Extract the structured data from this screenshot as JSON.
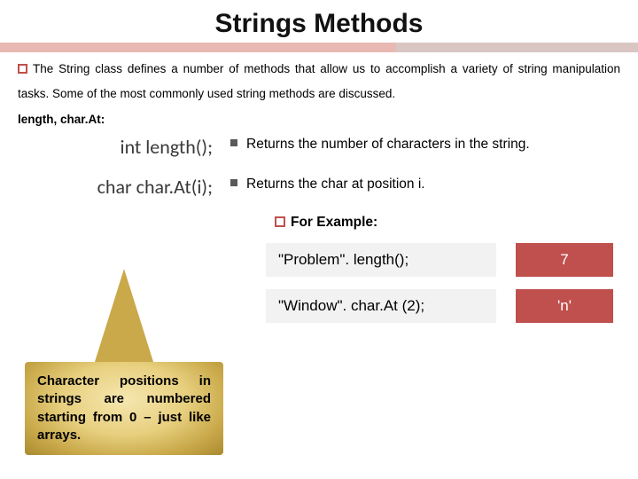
{
  "title": "Strings Methods",
  "intro": "The String class defines a number of methods that allow us to accomplish a variety of string manipulation tasks. Some of the most commonly used string methods are discussed.",
  "subhead": "length, char.At:",
  "methods": [
    {
      "sig": "int length();",
      "desc": "Returns the number of characters in the string."
    },
    {
      "sig": "char char.At(i);",
      "desc": "Returns the char at position i."
    }
  ],
  "example_label": "For Example:",
  "examples": [
    {
      "call": "\"Problem\". length();",
      "result": "7"
    },
    {
      "call": "\"Window\". char.At (2);",
      "result": "'n'"
    }
  ],
  "callout": "Character positions in strings are numbered starting from 0 – just like arrays."
}
